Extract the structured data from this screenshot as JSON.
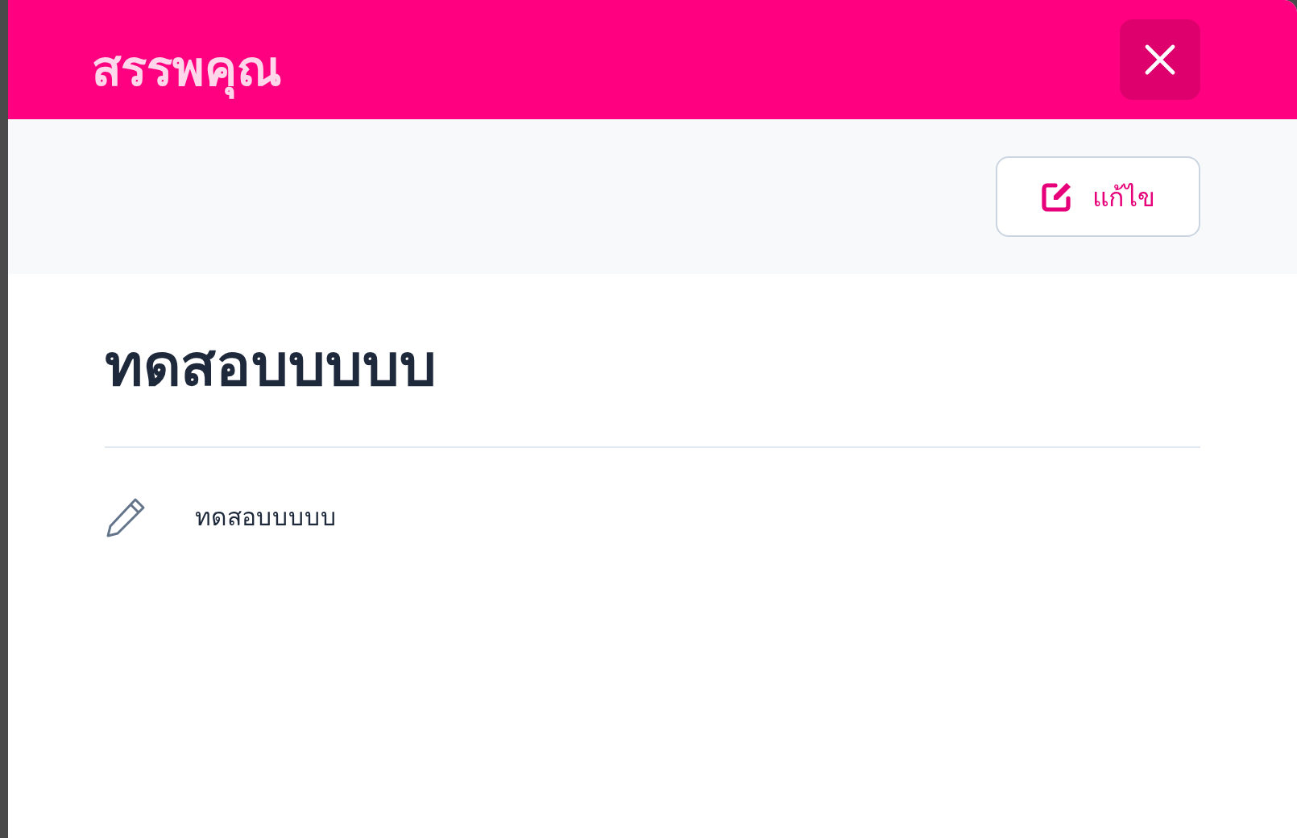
{
  "dialog": {
    "title": "สรรพคุณ"
  },
  "toolbar": {
    "edit_button": "แก้ไข"
  },
  "content": {
    "heading": "ทดสอบบบบบ",
    "items": [
      {
        "text": "ทดสอบบบบบ"
      }
    ]
  }
}
